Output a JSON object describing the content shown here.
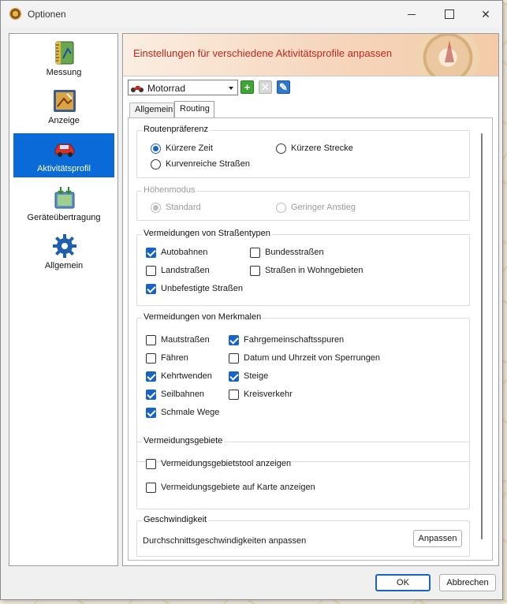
{
  "window": {
    "title": "Optionen"
  },
  "nav": {
    "items": [
      {
        "label": "Messung",
        "icon": "ruler-icon",
        "active": false
      },
      {
        "label": "Anzeige",
        "icon": "display-icon",
        "active": false
      },
      {
        "label": "Aktivitätsprofil",
        "icon": "car-icon",
        "active": true
      },
      {
        "label": "Geräteübertragung",
        "icon": "device-transfer-icon",
        "active": false
      },
      {
        "label": "Allgemein",
        "icon": "gear-icon",
        "active": false
      }
    ]
  },
  "header": {
    "title": "Einstellungen für verschiedene Aktivitätsprofile anpassen"
  },
  "profile": {
    "selected": "Motorrad"
  },
  "tabs": [
    {
      "label": "Allgemein",
      "active": false
    },
    {
      "label": "Routing",
      "active": true
    }
  ],
  "route_pref": {
    "legend": "Routenpräferenz",
    "options": {
      "shorter_time": "Kürzere Zeit",
      "shorter_distance": "Kürzere Strecke",
      "curvy": "Kurvenreiche Straßen"
    },
    "selected": "Kürzere Zeit"
  },
  "elevation": {
    "legend": "Höhenmodus",
    "options": {
      "standard": "Standard",
      "low_climb": "Geringer Anstieg"
    },
    "selected": "Standard",
    "enabled": false
  },
  "road_types": {
    "legend": "Vermeidungen von Straßentypen",
    "items": {
      "autobahnen": {
        "label": "Autobahnen",
        "checked": true
      },
      "bundesstrassen": {
        "label": "Bundesstraßen",
        "checked": false
      },
      "landstrassen": {
        "label": "Landstraßen",
        "checked": false
      },
      "wohngebiete": {
        "label": "Straßen in Wohngebieten",
        "checked": false
      },
      "unbefestigt": {
        "label": "Unbefestigte Straßen",
        "checked": true
      }
    }
  },
  "features": {
    "legend": "Vermeidungen von Merkmalen",
    "items": {
      "maut": {
        "label": "Mautstraßen",
        "checked": false
      },
      "fahrgemeinschaft": {
        "label": "Fahrgemeinschaftsspuren",
        "checked": true
      },
      "faehren": {
        "label": "Fähren",
        "checked": false
      },
      "sperrungen": {
        "label": "Datum und Uhrzeit von Sperrungen",
        "checked": false
      },
      "kehrtwenden": {
        "label": "Kehrtwenden",
        "checked": true
      },
      "steige": {
        "label": "Steige",
        "checked": true
      },
      "seilbahnen": {
        "label": "Seilbahnen",
        "checked": true
      },
      "kreisverkehr": {
        "label": "Kreisverkehr",
        "checked": false
      },
      "schmale": {
        "label": "Schmale Wege",
        "checked": true
      }
    }
  },
  "avoid_areas": {
    "legend": "Vermeidungsgebiete",
    "items": {
      "tool": {
        "label": "Vermeidungsgebietstool anzeigen",
        "checked": false
      },
      "map": {
        "label": "Vermeidungsgebiete auf Karte anzeigen",
        "checked": false
      }
    }
  },
  "speed": {
    "legend": "Geschwindigkeit",
    "text": "Durchschnittsgeschwindigkeiten anpassen",
    "button": "Anpassen"
  },
  "footer": {
    "ok": "OK",
    "cancel": "Abbrechen"
  },
  "colors": {
    "accent": "#1a63c6",
    "nav_active": "#0a6ad8",
    "header_title": "#c2281b"
  }
}
